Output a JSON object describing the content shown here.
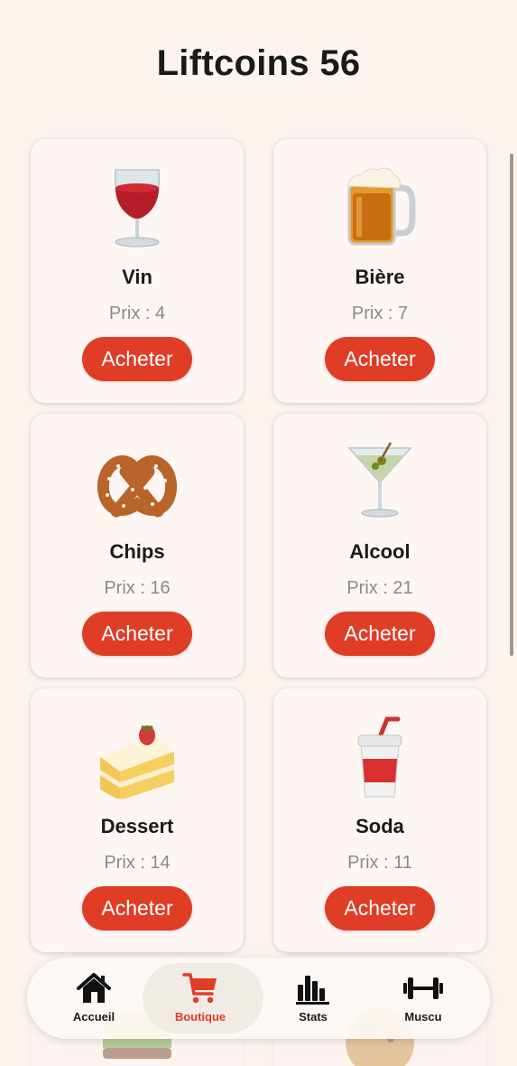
{
  "header": {
    "title": "Liftcoins 56"
  },
  "shop": {
    "buy_label": "Acheter",
    "items": [
      {
        "name": "Vin",
        "price": "Prix : 4",
        "icon": "wine-glass-icon"
      },
      {
        "name": "Bière",
        "price": "Prix : 7",
        "icon": "beer-mug-icon"
      },
      {
        "name": "Chips",
        "price": "Prix : 16",
        "icon": "pretzel-icon"
      },
      {
        "name": "Alcool",
        "price": "Prix : 21",
        "icon": "cocktail-glass-icon"
      },
      {
        "name": "Dessert",
        "price": "Prix : 14",
        "icon": "cake-slice-icon"
      },
      {
        "name": "Soda",
        "price": "Prix : 11",
        "icon": "soda-cup-icon"
      }
    ]
  },
  "tabbar": {
    "tabs": [
      {
        "label": "Accueil",
        "icon": "home-icon",
        "active": false
      },
      {
        "label": "Boutique",
        "icon": "cart-icon",
        "active": true
      },
      {
        "label": "Stats",
        "icon": "bar-chart-icon",
        "active": false
      },
      {
        "label": "Muscu",
        "icon": "dumbbell-icon",
        "active": false
      }
    ]
  },
  "colors": {
    "accent": "#df3d26",
    "background": "#fdf4f0",
    "card": "#fdf6f3"
  }
}
